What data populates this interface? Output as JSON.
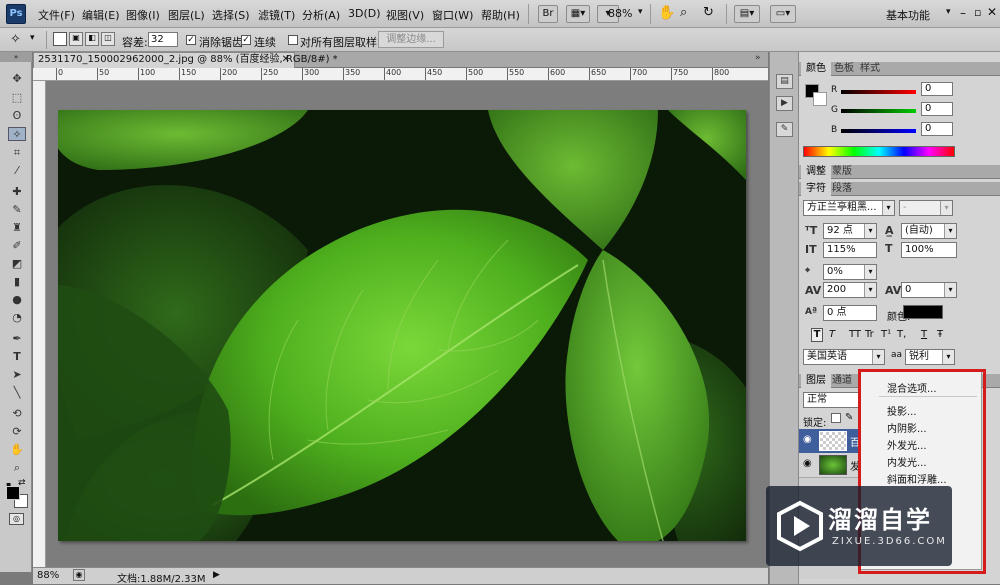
{
  "app": {
    "logo": "Ps",
    "workspace": "基本功能"
  },
  "menu": [
    "文件(F)",
    "编辑(E)",
    "图像(I)",
    "图层(L)",
    "选择(S)",
    "滤镜(T)",
    "分析(A)",
    "3D(D)",
    "视图(V)",
    "窗口(W)",
    "帮助(H)"
  ],
  "menubar": {
    "br_label": "Br",
    "zoom": "88%"
  },
  "options": {
    "tolerance_label": "容差:",
    "tolerance_value": "32",
    "antialias_label": "消除锯齿",
    "contiguous_label": "连续",
    "all_layers_label": "对所有图层取样",
    "refine_edge_label": "调整边缘..."
  },
  "document": {
    "tab_title": "2531170_150002962000_2.jpg @ 88% (百度经验, RGB/8#) *",
    "ruler_marks": [
      "0",
      "50",
      "100",
      "150",
      "200",
      "250",
      "300",
      "350",
      "400",
      "450",
      "500",
      "550",
      "600",
      "650",
      "700",
      "750",
      "800"
    ]
  },
  "status": {
    "zoom": "88%",
    "doc_size": "文档:1.88M/2.33M"
  },
  "color_panel": {
    "tabs": [
      "颜色",
      "色板",
      "样式"
    ],
    "r_label": "R",
    "g_label": "G",
    "b_label": "B",
    "r_value": "0",
    "g_value": "0",
    "b_value": "0"
  },
  "adjust_panel": {
    "tabs": [
      "调整",
      "蒙版"
    ]
  },
  "char_panel": {
    "tabs": [
      "字符",
      "段落"
    ],
    "font_family": "方正兰亭粗黑...",
    "font_style": "-",
    "font_size": "92 点",
    "leading": "(自动)",
    "vscale": "115%",
    "hscale": "100%",
    "baseline_pct": "0%",
    "tracking": "200",
    "kerning": "0",
    "baseline_shift": "0 点",
    "color_label": "颜色:",
    "language": "美国英语",
    "aa_label": "aa",
    "antialias": "锐利",
    "style_buttons": [
      "T",
      "T",
      "TT",
      "Tr",
      "T¹",
      "T,",
      "T",
      "Ŧ"
    ]
  },
  "layers_panel": {
    "tabs": [
      "图层",
      "通道"
    ],
    "blend_mode": "正常",
    "lock_label": "锁定:",
    "layer1_name": "百",
    "layer2_name": "发"
  },
  "context_menu": {
    "items": [
      "混合选项...",
      "投影...",
      "内阴影...",
      "外发光...",
      "内发光...",
      "斜面和浮雕..."
    ]
  },
  "watermark": {
    "title": "溜溜自学",
    "url": "ZIXUE.3D66.COM"
  }
}
